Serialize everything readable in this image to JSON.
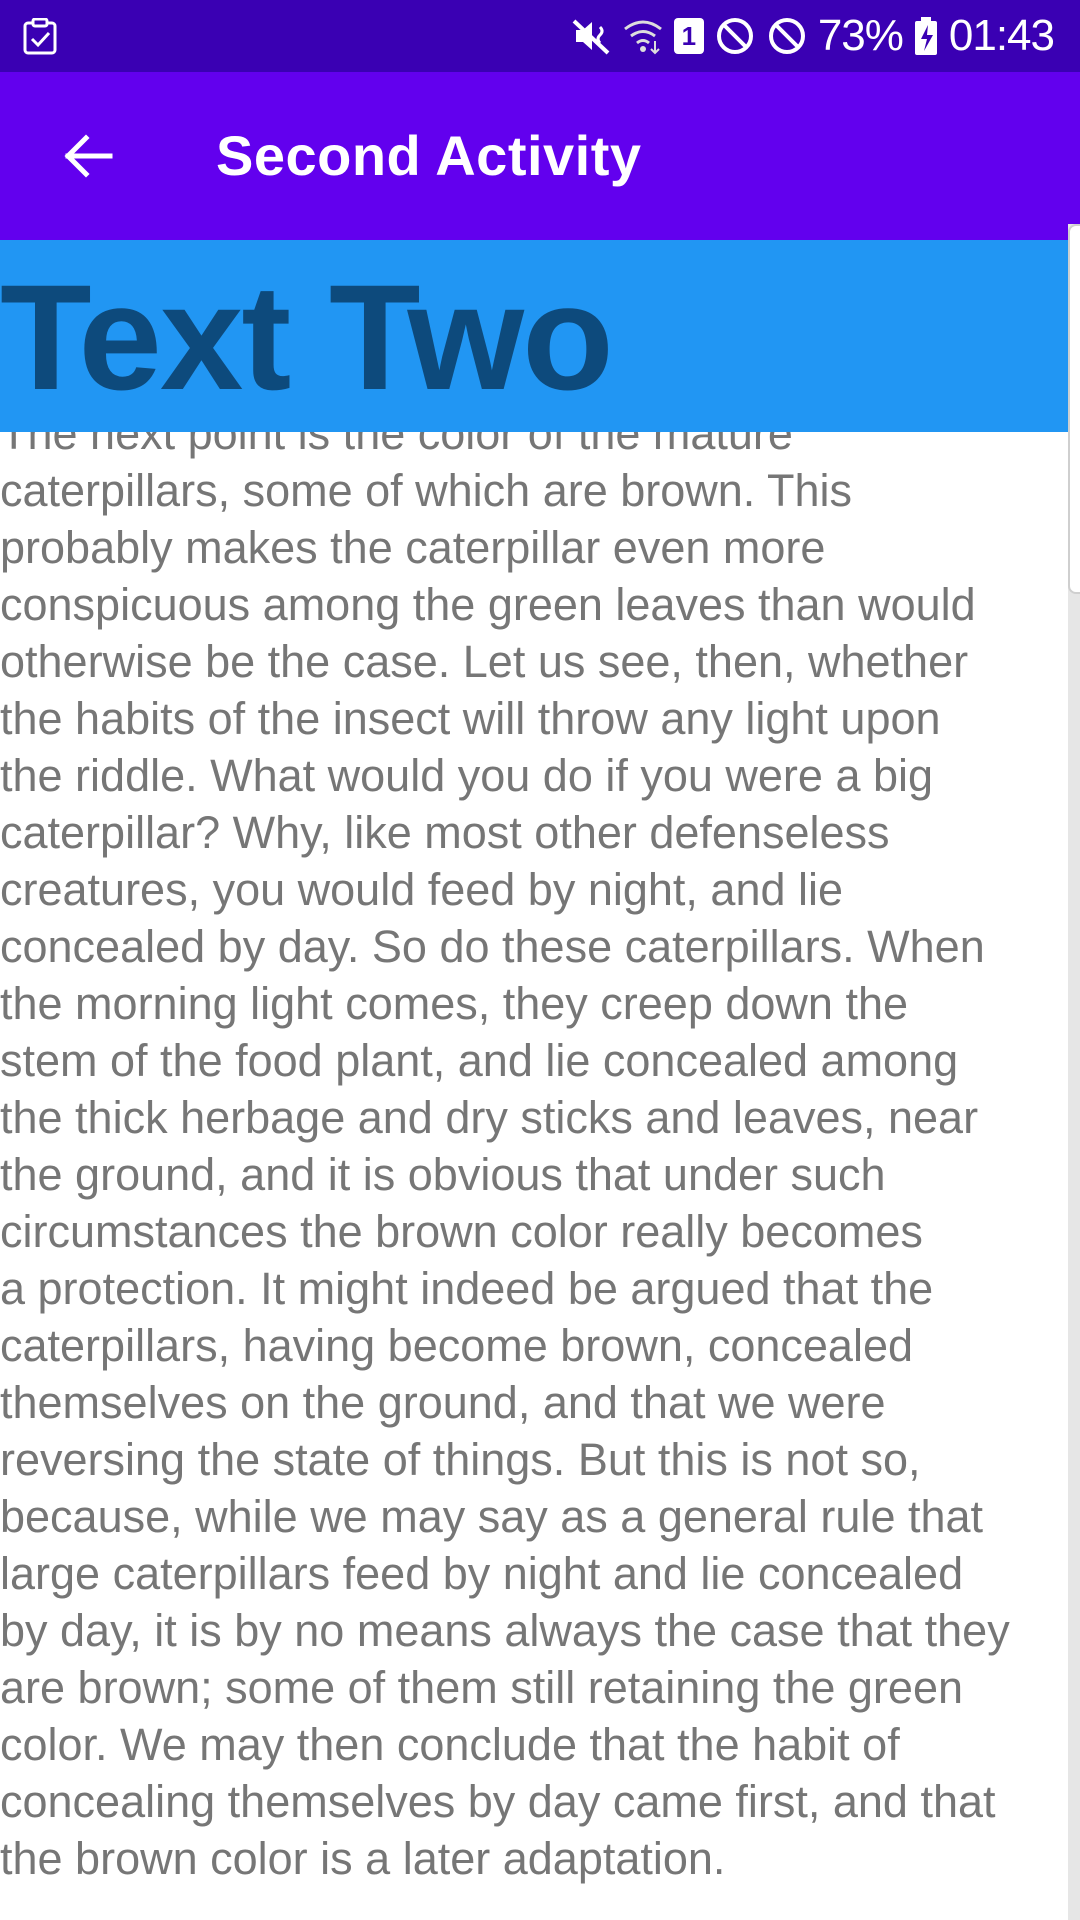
{
  "status_bar": {
    "battery": "73%",
    "time": "01:43",
    "sim_slot": "1",
    "icons": [
      "task-check-icon",
      "mute-vibrate-icon",
      "wifi-icon",
      "sim-icon",
      "no-entry-icon",
      "no-entry-icon",
      "battery-charging-icon"
    ]
  },
  "app_bar": {
    "title": "Second Activity",
    "back_icon": "arrow-left-icon"
  },
  "header": {
    "text": "Text Two"
  },
  "content": {
    "text": "The next point is the color of the mature\ncaterpillars, some of which are brown. This\nprobably makes the caterpillar even more\nconspicuous among the green leaves than would\notherwise be the case. Let us see, then, whether\nthe habits of the insect will throw any light upon\nthe riddle. What would you do if you were a big\ncaterpillar? Why, like most other defenseless\ncreatures, you would feed by night, and lie\nconcealed by day. So do these caterpillars. When\nthe morning light comes, they creep down the\nstem of the food plant, and lie concealed among\nthe thick herbage and dry sticks and leaves, near\nthe ground, and it is obvious that under such\ncircumstances the brown color really becomes\na protection. It might indeed be argued that the\ncaterpillars, having become brown, concealed\nthemselves on the ground, and that we were\nreversing the state of things. But this is not so,\nbecause, while we may say as a general rule that\nlarge caterpillars feed by night and lie concealed\nby day, it is by no means always the case that they\nare brown; some of them still retaining the green\ncolor. We may then conclude that the habit of\nconcealing themselves by day came first, and that\nthe brown color is a later adaptation."
  },
  "colors": {
    "status_bar": "#3a00b3",
    "app_bar": "#6200ee",
    "header_band": "#2196f3",
    "header_text": "#0d4a7c",
    "body_text": "#767676"
  }
}
